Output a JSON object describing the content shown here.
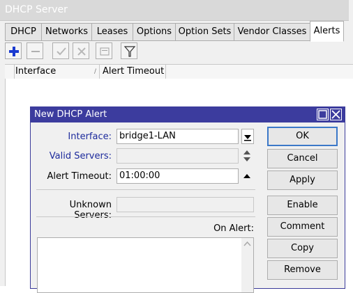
{
  "window": {
    "title": "DHCP Server"
  },
  "tabs": [
    {
      "label": "DHCP"
    },
    {
      "label": "Networks"
    },
    {
      "label": "Leases"
    },
    {
      "label": "Options"
    },
    {
      "label": "Option Sets"
    },
    {
      "label": "Vendor Classes"
    },
    {
      "label": "Alerts"
    }
  ],
  "toolbar": {
    "buttons": [
      "plus-icon",
      "minus-icon",
      "check-icon",
      "cross-icon",
      "comment-icon",
      "filter-icon"
    ],
    "accent": "#1a3ad0"
  },
  "list": {
    "columns": [
      {
        "label": "Interface"
      },
      {
        "label": "Alert Timeout"
      }
    ]
  },
  "dialog": {
    "title": "New DHCP Alert",
    "title_bg": "#3c3c9e",
    "interface": {
      "label": "Interface:",
      "value": "bridge1-LAN"
    },
    "valid_servers": {
      "label": "Valid Servers:",
      "value": ""
    },
    "alert_timeout": {
      "label": "Alert Timeout:",
      "value": "01:00:00"
    },
    "unknown_servers": {
      "label": "Unknown Servers:",
      "value": ""
    },
    "on_alert": {
      "label": "On Alert:"
    },
    "buttons": {
      "ok": "OK",
      "cancel": "Cancel",
      "apply": "Apply",
      "enable": "Enable",
      "comment": "Comment",
      "copy": "Copy",
      "remove": "Remove"
    }
  }
}
